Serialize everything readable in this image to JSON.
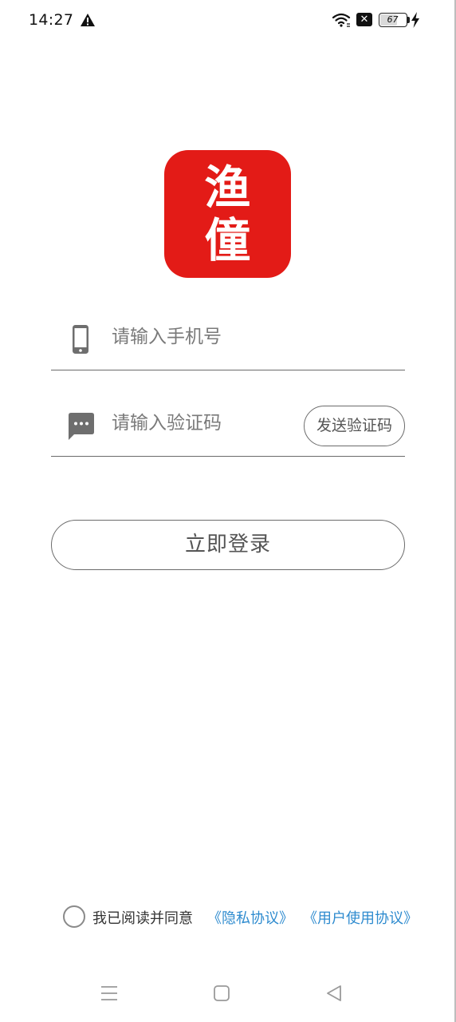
{
  "status_bar": {
    "time": "14:27",
    "battery_level": "67",
    "battery_percent": 67,
    "icons": [
      "warning-icon",
      "wifi-icon",
      "sim-x-icon",
      "battery-icon",
      "charging-bolt-icon"
    ]
  },
  "logo": {
    "text_line1": "渔",
    "text_line2": "僮",
    "background_color": "#e31b17"
  },
  "form": {
    "phone_placeholder": "请输入手机号",
    "phone_value": "",
    "code_placeholder": "请输入验证码",
    "code_value": "",
    "send_code_label": "发送验证码",
    "login_label": "立即登录"
  },
  "agreement": {
    "checked": false,
    "text": "我已阅读并同意",
    "privacy_link": "《隐私协议》",
    "terms_link": "《用户使用协议》",
    "link_color": "#2e8bcf"
  },
  "nav_bar": {
    "icons": [
      "menu-icon",
      "home-icon",
      "back-icon"
    ]
  }
}
